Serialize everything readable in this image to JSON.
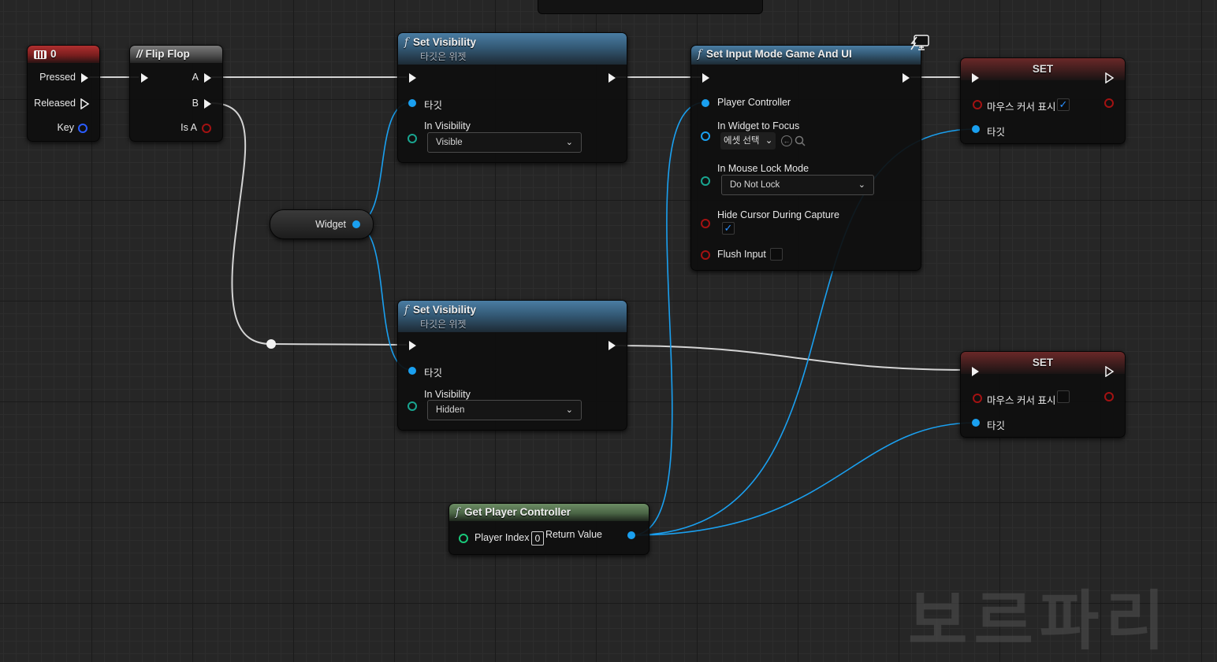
{
  "nodes": {
    "key_event": {
      "title": "0",
      "pins": {
        "pressed": "Pressed",
        "released": "Released",
        "key": "Key"
      }
    },
    "flip_flop": {
      "title": "Flip Flop",
      "pins": {
        "a": "A",
        "b": "B",
        "is_a": "Is A"
      }
    },
    "set_visibility_1": {
      "title": "Set Visibility",
      "subtitle": "타깃은 위젯",
      "target_label": "타깃",
      "visibility_label": "In Visibility",
      "visibility_value": "Visible"
    },
    "set_visibility_2": {
      "title": "Set Visibility",
      "subtitle": "타깃은 위젯",
      "target_label": "타깃",
      "visibility_label": "In Visibility",
      "visibility_value": "Hidden"
    },
    "widget_var": {
      "label": "Widget"
    },
    "set_input_mode": {
      "title": "Set Input Mode Game And UI",
      "player_controller_label": "Player Controller",
      "widget_focus_label": "In Widget to Focus",
      "widget_focus_value": "에셋 선택",
      "mouse_lock_label": "In Mouse Lock Mode",
      "mouse_lock_value": "Do Not Lock",
      "hide_cursor_label": "Hide Cursor During Capture",
      "hide_cursor_checked": true,
      "flush_input_label": "Flush Input",
      "flush_input_checked": false
    },
    "set_1": {
      "title": "SET",
      "show_cursor_label": "마우스 커서 표시",
      "show_cursor_checked": true,
      "target_label": "타깃"
    },
    "set_2": {
      "title": "SET",
      "show_cursor_label": "마우스 커서 표시",
      "show_cursor_checked": false,
      "target_label": "타깃"
    },
    "get_player_controller": {
      "title": "Get Player Controller",
      "player_index_label": "Player Index",
      "player_index_value": "0",
      "return_value_label": "Return Value"
    }
  },
  "colors": {
    "exec_wire": "#d8d8d8",
    "object_wire": "#1aa0f0",
    "function_header": "#345a76",
    "event_header": "#7a1e1e",
    "pure_header": "#4a6445"
  },
  "icons": {
    "keyboard": "keyboard-icon",
    "function": "function-icon",
    "flipflop": "flipflop-icon",
    "network": "network-icon"
  }
}
